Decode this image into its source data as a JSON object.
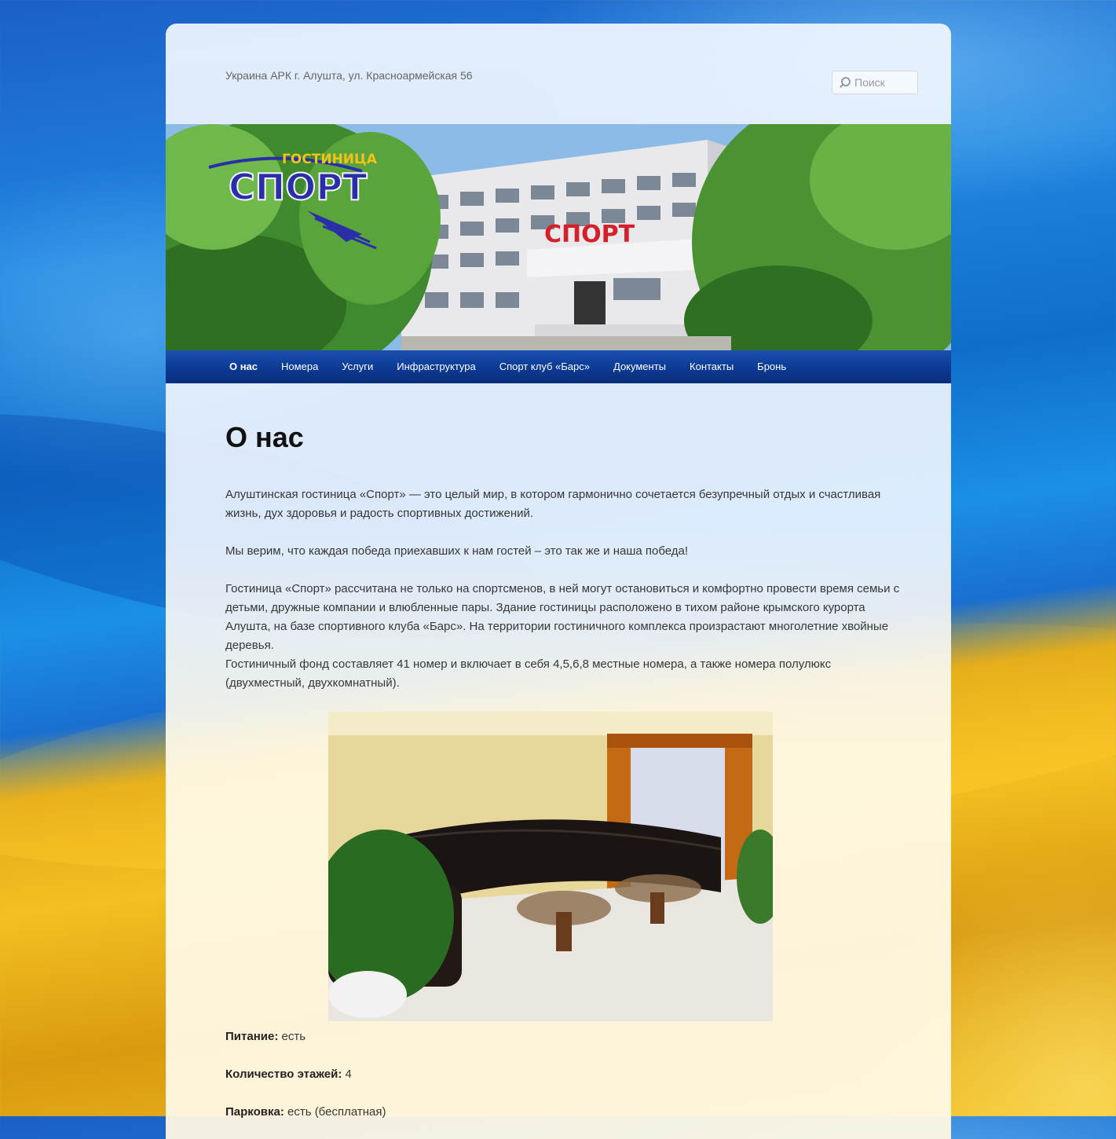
{
  "header": {
    "tagline": "Украина АРК г. Алушта, ул. Красноармейская 56",
    "search_placeholder": "Поиск"
  },
  "banner": {
    "logo_top": "ГОСТИНИЦА",
    "logo_main": "СПОРТ",
    "building_sign": "СПОРТ"
  },
  "nav": {
    "items": [
      {
        "label": "О нас",
        "active": true
      },
      {
        "label": "Номера"
      },
      {
        "label": "Услуги"
      },
      {
        "label": "Инфраструктура"
      },
      {
        "label": "Спорт клуб «Барс»"
      },
      {
        "label": "Документы"
      },
      {
        "label": "Контакты"
      },
      {
        "label": "Бронь"
      }
    ]
  },
  "page": {
    "title": "О нас",
    "paragraphs": [
      "Алуштинская гостиница «Спорт» — это целый мир, в котором гармонично сочетается безупречный отдых и счастливая жизнь, дух здоровья и радость спортивных достижений.",
      "Мы верим, что каждая победа приехавших к нам гостей – это так же и наша победа!",
      "Гостиница «Спорт» рассчитана не только на спортсменов, в ней могут остановиться и комфортно провести время семьи с детьми, дружные компании и влюбленные пары. Здание гостиницы расположено в тихом районе крымского курорта Алушта, на базе спортивного клуба «Барс». На территории  гостиничного комплекса произрастают многолетние хвойные деревья.",
      "Гостиничный фонд составляет 41 номер и включает в себя 4,5,6,8 местные номера, а также номера полулюкс (двухместный, двухкомнатный)."
    ],
    "facts": [
      {
        "label": "Питание:",
        "value": " есть"
      },
      {
        "label": "Количество этажей:",
        "value": " 4"
      },
      {
        "label": "Парковка:",
        "value": " есть (бесплатная)"
      }
    ]
  },
  "colors": {
    "nav_bg": "#0c3a93",
    "logo_blue": "#2a2fa8",
    "logo_sign_red": "#d4202a",
    "logo_yellow": "#f4c21c"
  }
}
